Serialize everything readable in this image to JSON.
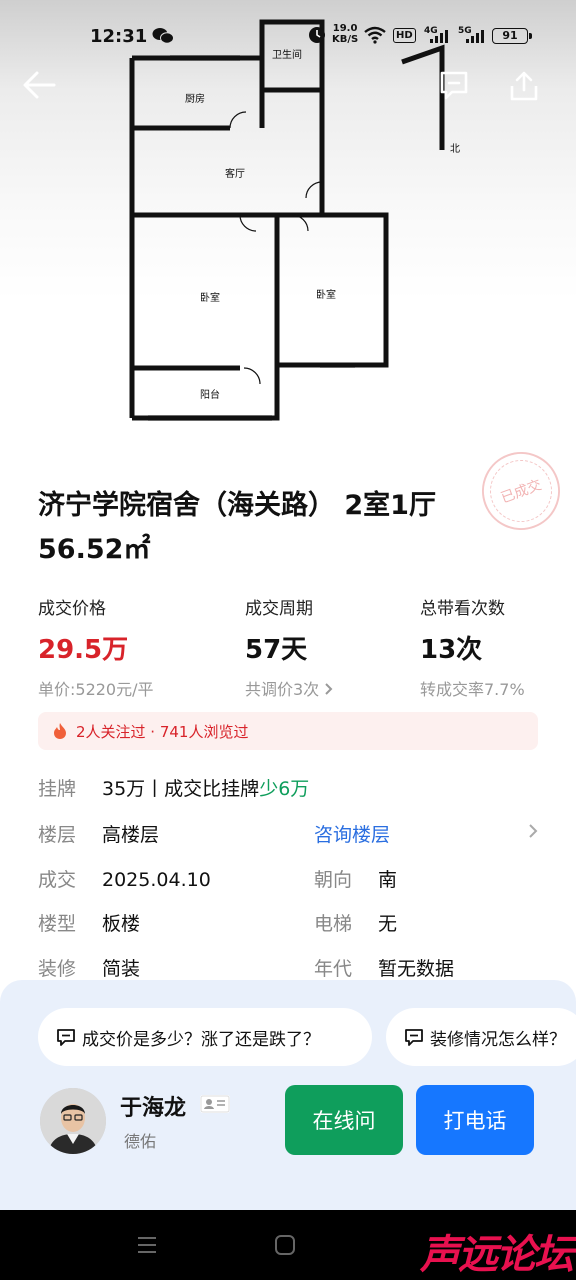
{
  "status_bar": {
    "time": "12:31",
    "net_speed_value": "19.0",
    "net_speed_unit": "KB/S",
    "hd": "HD",
    "sig1": "4G",
    "sig2": "5G",
    "battery": "91"
  },
  "floor_plan": {
    "rooms": {
      "bathroom": "卫生间",
      "kitchen": "厨房",
      "living": "客厅",
      "bedroom1": "卧室",
      "bedroom2": "卧室",
      "balcony": "阳台"
    },
    "north": "北"
  },
  "stamp": "已成交",
  "title": "济宁学院宿舍（海关路） 2室1厅 56.52㎡",
  "stats": [
    {
      "label": "成交价格",
      "value": "29.5万",
      "sub": "单价:5220元/平"
    },
    {
      "label": "成交周期",
      "value": "57天",
      "sub": "共调价3次"
    },
    {
      "label": "总带看次数",
      "value": "13次",
      "sub": "转成交率7.7%"
    }
  ],
  "notice": "2人关注过 · 741人浏览过",
  "details": {
    "listing_key": "挂牌",
    "listing_val": "35万丨成交比挂牌",
    "listing_diff": "少6万",
    "floor_key": "楼层",
    "floor_val": "高楼层",
    "floor_link": "咨询楼层",
    "deal_key": "成交",
    "deal_val": "2025.04.10",
    "orient_key": "朝向",
    "orient_val": "南",
    "type_key": "楼型",
    "type_val": "板楼",
    "elevator_key": "电梯",
    "elevator_val": "无",
    "deco_key": "装修",
    "deco_val": "简装",
    "year_key": "年代",
    "year_val": "暂无数据"
  },
  "chips": [
    "成交价是多少？涨了还是跌了？",
    "装修情况怎么样？"
  ],
  "agent": {
    "name": "于海龙",
    "company": "德佑"
  },
  "buttons": {
    "chat": "在线问",
    "call": "打电话"
  },
  "watermark": "声远论坛",
  "colors": {
    "price_red": "#d8232a",
    "green": "#0f9e5c",
    "blue": "#1677ff"
  }
}
